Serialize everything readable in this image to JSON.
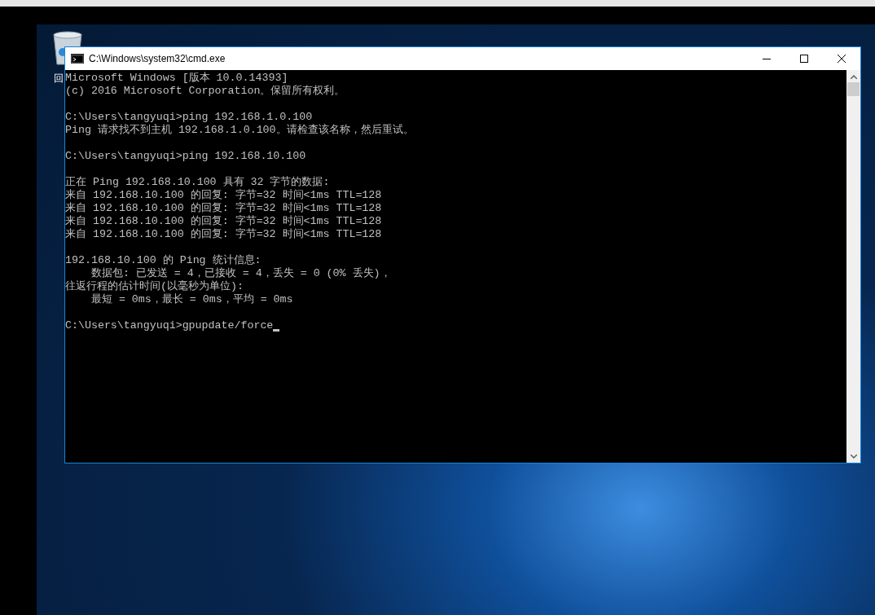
{
  "desktop": {
    "icon_label": "回"
  },
  "window": {
    "title": "C:\\Windows\\system32\\cmd.exe"
  },
  "console": {
    "blocks": [
      [
        "Microsoft Windows [版本 10.0.14393]",
        "(c) 2016 Microsoft Corporation。保留所有权利。"
      ],
      [
        "C:\\Users\\tangyuqi>ping 192.168.1.0.100",
        "Ping 请求找不到主机 192.168.1.0.100。请检查该名称，然后重试。"
      ],
      [
        "C:\\Users\\tangyuqi>ping 192.168.10.100"
      ],
      [
        "正在 Ping 192.168.10.100 具有 32 字节的数据:",
        "来自 192.168.10.100 的回复: 字节=32 时间<1ms TTL=128",
        "来自 192.168.10.100 的回复: 字节=32 时间<1ms TTL=128",
        "来自 192.168.10.100 的回复: 字节=32 时间<1ms TTL=128",
        "来自 192.168.10.100 的回复: 字节=32 时间<1ms TTL=128"
      ],
      [
        "192.168.10.100 的 Ping 统计信息:",
        "    数据包: 已发送 = 4，已接收 = 4，丢失 = 0 (0% 丢失)，",
        "往返行程的估计时间(以毫秒为单位):",
        "    最短 = 0ms，最长 = 0ms，平均 = 0ms"
      ],
      [
        "C:\\Users\\tangyuqi>gpupdate/force"
      ]
    ]
  }
}
